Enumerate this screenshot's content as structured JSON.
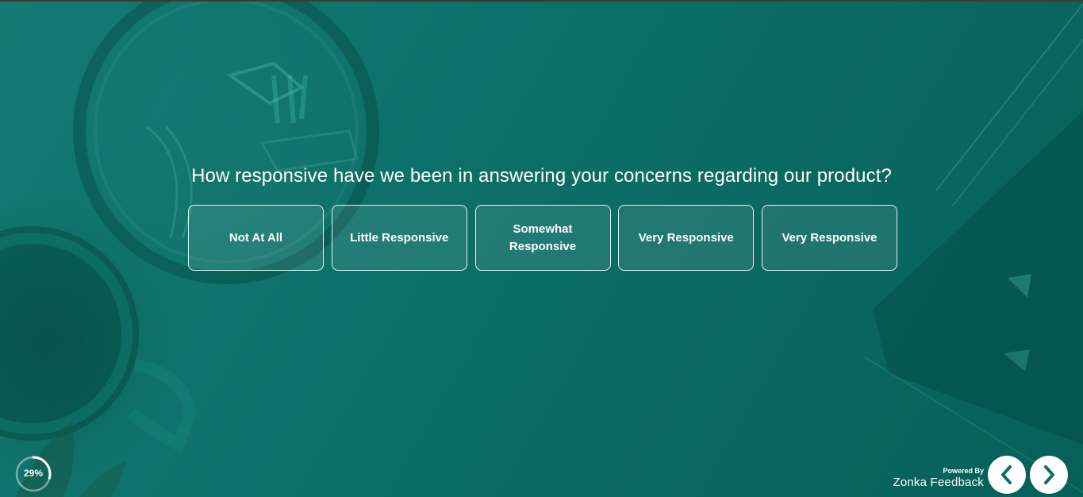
{
  "survey": {
    "question": "How responsive have we been in answering your concerns regarding our product?",
    "options": [
      {
        "label": "Not At All"
      },
      {
        "label": "Little Responsive"
      },
      {
        "label": "Somewhat Responsive"
      },
      {
        "label": "Very Responsive"
      },
      {
        "label": "Very Responsive"
      }
    ]
  },
  "progress": {
    "label": "29%",
    "value": 0.29
  },
  "footer": {
    "powered_by": "Powered By",
    "brand": "Zonka Feedback"
  },
  "nav": {
    "prev_icon": "chevron-left-icon",
    "next_icon": "chevron-right-icon"
  },
  "colors": {
    "background": "#0e6f69",
    "accent": "#0e6f69",
    "text": "#ffffff"
  }
}
